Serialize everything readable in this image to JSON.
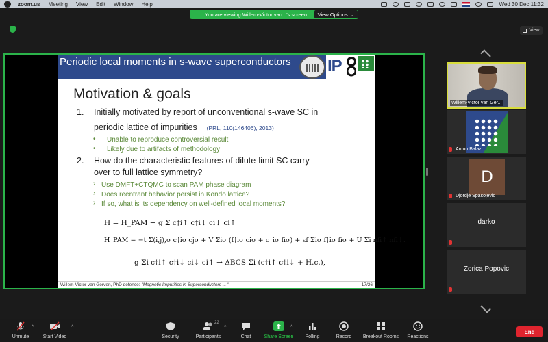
{
  "menubar": {
    "app": "zoom.us",
    "items": [
      "Meeting",
      "View",
      "Edit",
      "Window",
      "Help"
    ],
    "clock": "Wed 30 Dec  11:32"
  },
  "banner": {
    "text": "You are viewing Willem-Victor van...'s screen",
    "view_options": "View Options"
  },
  "view_button": "View",
  "slide": {
    "title": "Periodic local moments in s-wave superconductors",
    "heading": "Motivation & goals",
    "item1_num": "1.",
    "item1_line1": "Initially motivated by report of unconventional s-wave SC in",
    "item1_line2": "periodic lattice of impurities",
    "item1_ref": "(PRL, 110(146406), 2013)",
    "item1_b1": "Unable to reproduce controversial result",
    "item1_b2": "Likely due to artifacts of methodology",
    "item2_num": "2.",
    "item2_line1": "How do the characteristic features of dilute-limit SC carry",
    "item2_line2": "over to full lattice symmetry?",
    "item2_b1": "Use DMFT+CTQMC to scan PAM phase diagram",
    "item2_b2": "Does reentrant behavior persist in Kondo lattice?",
    "item2_b3": "If so, what is its dependency on well-defined local moments?",
    "eq1": "H = H_PAM − g Σ c†i↑ c†i↓ ci↓ ci↑",
    "eq2": "H_PAM = −t Σ(i,j),σ c†iσ cjσ + V Σiσ (f†iσ ciσ + c†iσ fiσ) + εf Σiσ f†iσ fiσ + U Σi nfi↑ nfi↓.",
    "eq3": "g Σi c†i↑ c†i↓ ci↓ ci↑ → ΔBCS Σi (c†i↑ c†i↓ + H.c.),",
    "footer_left": "Willem-Victor van Gerven, PhD defence:",
    "footer_left_italic": "\"Magnetic Impurities in Superconductors ... \"",
    "footer_right": "17/26",
    "logo_text": "IP"
  },
  "participants": [
    {
      "name": "Willem-Victor van Ger...",
      "type": "video"
    },
    {
      "name": "Antun Balaz",
      "type": "logo"
    },
    {
      "name": "Djordje Spasojevic",
      "initial": "D",
      "type": "avatar"
    },
    {
      "name": "darko",
      "type": "name"
    },
    {
      "name": "Zorica Popovic",
      "type": "name"
    }
  ],
  "toolbar": {
    "unmute": "Unmute",
    "start_video": "Start Video",
    "security": "Security",
    "participants": "Participants",
    "participants_count": "22",
    "chat": "Chat",
    "share_screen": "Share Screen",
    "polling": "Polling",
    "record": "Record",
    "breakout": "Breakout Rooms",
    "reactions": "Reactions",
    "end": "End"
  }
}
